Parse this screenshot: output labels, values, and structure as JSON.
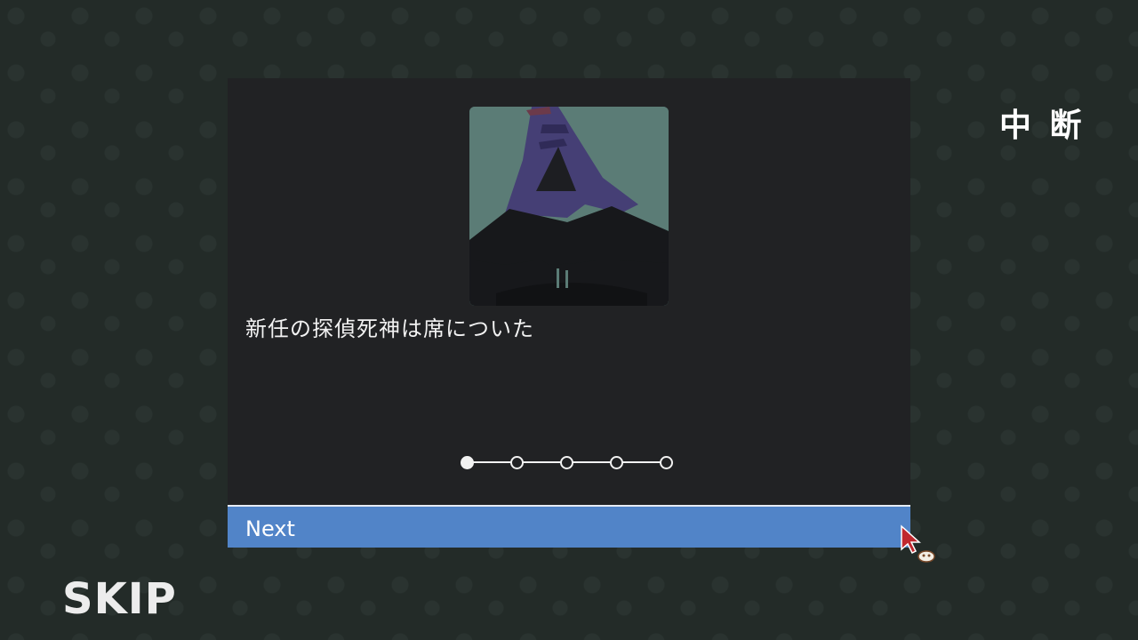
{
  "dialog": {
    "message": "新任の探偵死神は席についた",
    "next_label": "Next",
    "pager": {
      "total": 5,
      "current": 1
    }
  },
  "controls": {
    "interrupt_label": "中 断",
    "skip_label": "SKIP"
  },
  "colors": {
    "background": "#232b28",
    "panel": "#212224",
    "next_bar": "#5184c8",
    "portrait_bg": "#5b7c76",
    "robe": "#453f75"
  },
  "icons": {
    "cursor": "cursor-arrow-icon"
  }
}
